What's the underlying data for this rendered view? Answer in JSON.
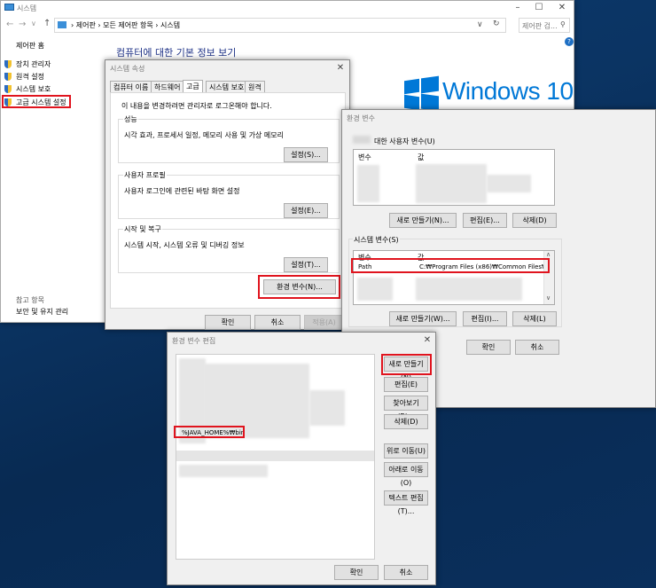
{
  "system_window": {
    "title": "시스템",
    "breadcrumb": [
      "제어판",
      "모든 제어판 항목",
      "시스템"
    ],
    "search_placeholder": "제어판 검...",
    "sidebar": {
      "home": "제어판 홈",
      "items": [
        "장치 관리자",
        "원격 설정",
        "시스템 보호",
        "고급 시스템 설정"
      ],
      "see_also": "참고 항목",
      "security": "보안 및 유지 관리"
    },
    "main_heading": "컴퓨터에 대한 기본 정보 보기",
    "logo_text": "Windows 10",
    "accent": "#0078d7"
  },
  "sys_props": {
    "title": "시스템 속성",
    "tabs": [
      "컴퓨터 이름",
      "하드웨어",
      "고급",
      "시스템 보호",
      "원격"
    ],
    "intro": "이 내용을 변경하려면 관리자로 로그온해야 합니다.",
    "perf": {
      "label": "성능",
      "desc": "시각 효과, 프로세서 일정, 메모리 사용 및 가상 메모리",
      "button": "설정(S)..."
    },
    "profile": {
      "label": "사용자 프로필",
      "desc": "사용자 로그인에 관련된 바탕 화면 설정",
      "button": "설정(E)..."
    },
    "startup": {
      "label": "시작 및 복구",
      "desc": "시스템 시작, 시스템 오류 및 디버깅 정보",
      "button": "설정(T)..."
    },
    "env_button": "환경 변수(N)...",
    "ok": "확인",
    "cancel": "취소",
    "apply": "적용(A)"
  },
  "env_vars": {
    "title": "환경 변수",
    "user_label": "대한 사용자 변수(U)",
    "col_var": "변수",
    "col_val": "값",
    "user_buttons": [
      "새로 만들기(N)...",
      "편집(E)...",
      "삭제(D)"
    ],
    "sys_label": "시스템 변수(S)",
    "path_row": {
      "name": "Path",
      "value": "C:₩Program Files (x86)₩Common Files₩Or..."
    },
    "sys_buttons": [
      "새로 만들기(W)...",
      "편집(I)...",
      "삭제(L)"
    ],
    "ok": "확인",
    "cancel": "취소"
  },
  "edit_env": {
    "title": "환경 변수 편집",
    "new_entry": "%JAVA_HOME%₩bin",
    "buttons": [
      "새로 만들기(N)",
      "편집(E)",
      "찾아보기(B)...",
      "삭제(D)",
      "위로 이동(U)",
      "아래로 이동(O)",
      "텍스트 편집(T)..."
    ],
    "ok": "확인",
    "cancel": "취소"
  },
  "colors": {
    "highlight": "#e0141e",
    "desktop": "#0b3463"
  }
}
